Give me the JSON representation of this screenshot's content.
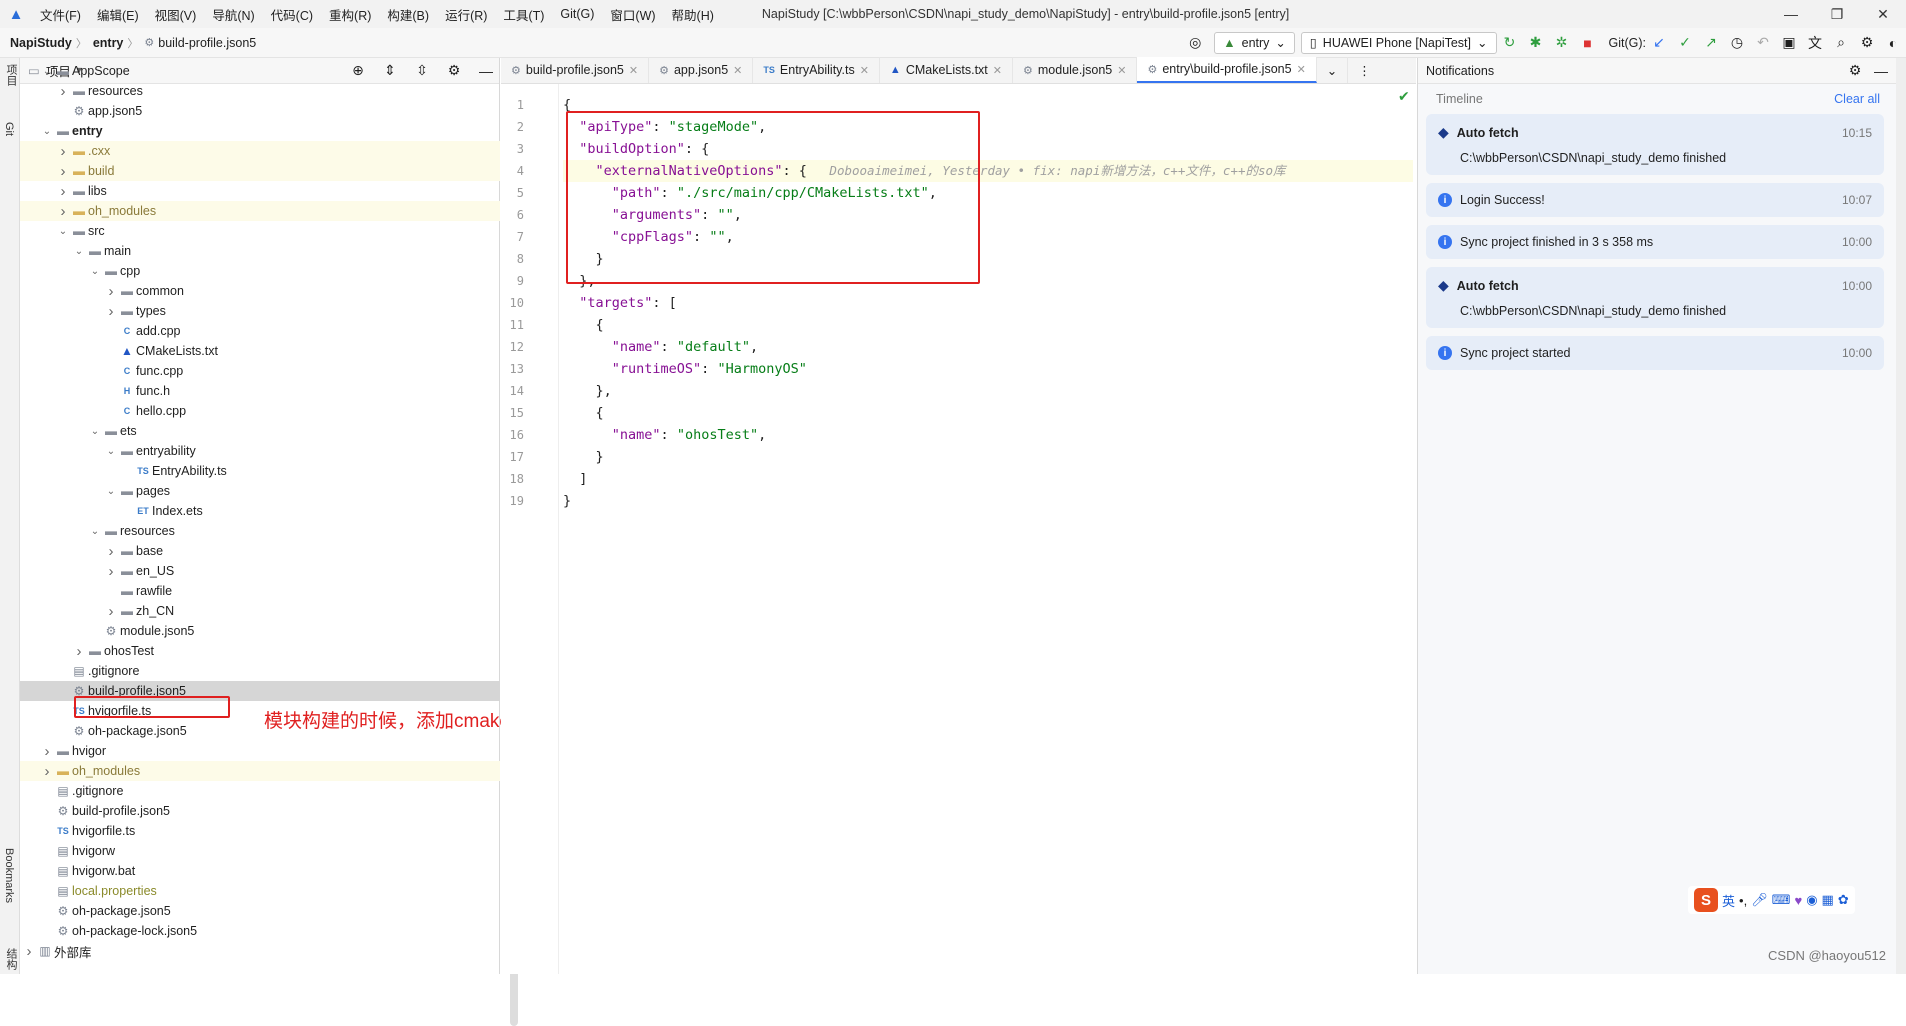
{
  "menubar": {
    "items": [
      "文件(F)",
      "编辑(E)",
      "视图(V)",
      "导航(N)",
      "代码(C)",
      "重构(R)",
      "构建(B)",
      "运行(R)",
      "工具(T)",
      "Git(G)",
      "窗口(W)",
      "帮助(H)"
    ],
    "title": "NapiStudy [C:\\wbbPerson\\CSDN\\napi_study_demo\\NapiStudy] - entry\\build-profile.json5 [entry]"
  },
  "navbar": {
    "breadcrumb": [
      "NapiStudy",
      "entry",
      "build-profile.json5"
    ],
    "module": "entry",
    "device": "HUAWEI Phone [NapiTest]",
    "git_label": "Git(G):"
  },
  "leftstrip": {
    "project": "项目",
    "git": "Git",
    "bookmarks": "Bookmarks",
    "structure": "结构"
  },
  "project": {
    "title": "项目",
    "tree": [
      {
        "label": "AppScope",
        "depth": 0,
        "arrow": "open",
        "icon": "folder"
      },
      {
        "label": "resources",
        "depth": 1,
        "arrow": "closed",
        "icon": "folder"
      },
      {
        "label": "app.json5",
        "depth": 1,
        "arrow": "",
        "icon": "json"
      },
      {
        "label": "entry",
        "depth": 0,
        "arrow": "open",
        "icon": "folder",
        "bold": true
      },
      {
        "label": ".cxx",
        "depth": 1,
        "arrow": "closed",
        "icon": "folder-y",
        "hl": true,
        "dim": true
      },
      {
        "label": "build",
        "depth": 1,
        "arrow": "closed",
        "icon": "folder-y",
        "hl": true,
        "dim": true
      },
      {
        "label": "libs",
        "depth": 1,
        "arrow": "closed",
        "icon": "folder"
      },
      {
        "label": "oh_modules",
        "depth": 1,
        "arrow": "closed",
        "icon": "folder-y",
        "hl": true,
        "dim": true
      },
      {
        "label": "src",
        "depth": 1,
        "arrow": "open",
        "icon": "folder"
      },
      {
        "label": "main",
        "depth": 2,
        "arrow": "open",
        "icon": "folder"
      },
      {
        "label": "cpp",
        "depth": 3,
        "arrow": "open",
        "icon": "folder"
      },
      {
        "label": "common",
        "depth": 4,
        "arrow": "closed",
        "icon": "folder"
      },
      {
        "label": "types",
        "depth": 4,
        "arrow": "closed",
        "icon": "folder"
      },
      {
        "label": "add.cpp",
        "depth": 4,
        "arrow": "",
        "icon": "cpp"
      },
      {
        "label": "CMakeLists.txt",
        "depth": 4,
        "arrow": "",
        "icon": "cmake"
      },
      {
        "label": "func.cpp",
        "depth": 4,
        "arrow": "",
        "icon": "cpp"
      },
      {
        "label": "func.h",
        "depth": 4,
        "arrow": "",
        "icon": "h"
      },
      {
        "label": "hello.cpp",
        "depth": 4,
        "arrow": "",
        "icon": "cpp"
      },
      {
        "label": "ets",
        "depth": 3,
        "arrow": "open",
        "icon": "folder"
      },
      {
        "label": "entryability",
        "depth": 4,
        "arrow": "open",
        "icon": "folder"
      },
      {
        "label": "EntryAbility.ts",
        "depth": 5,
        "arrow": "",
        "icon": "ts"
      },
      {
        "label": "pages",
        "depth": 4,
        "arrow": "open",
        "icon": "folder"
      },
      {
        "label": "Index.ets",
        "depth": 5,
        "arrow": "",
        "icon": "ets"
      },
      {
        "label": "resources",
        "depth": 3,
        "arrow": "open",
        "icon": "folder"
      },
      {
        "label": "base",
        "depth": 4,
        "arrow": "closed",
        "icon": "folder"
      },
      {
        "label": "en_US",
        "depth": 4,
        "arrow": "closed",
        "icon": "folder"
      },
      {
        "label": "rawfile",
        "depth": 4,
        "arrow": "",
        "icon": "folder"
      },
      {
        "label": "zh_CN",
        "depth": 4,
        "arrow": "closed",
        "icon": "folder"
      },
      {
        "label": "module.json5",
        "depth": 3,
        "arrow": "",
        "icon": "json"
      },
      {
        "label": "ohosTest",
        "depth": 2,
        "arrow": "closed",
        "icon": "folder"
      },
      {
        "label": ".gitignore",
        "depth": 1,
        "arrow": "",
        "icon": "file"
      },
      {
        "label": "build-profile.json5",
        "depth": 1,
        "arrow": "",
        "icon": "json",
        "sel": true
      },
      {
        "label": "hvigorfile.ts",
        "depth": 1,
        "arrow": "",
        "icon": "ts"
      },
      {
        "label": "oh-package.json5",
        "depth": 1,
        "arrow": "",
        "icon": "json"
      },
      {
        "label": "hvigor",
        "depth": 0,
        "arrow": "closed",
        "icon": "folder"
      },
      {
        "label": "oh_modules",
        "depth": 0,
        "arrow": "closed",
        "icon": "folder-y",
        "hl": true,
        "dim": true
      },
      {
        "label": ".gitignore",
        "depth": 0,
        "arrow": "",
        "icon": "file"
      },
      {
        "label": "build-profile.json5",
        "depth": 0,
        "arrow": "",
        "icon": "json"
      },
      {
        "label": "hvigorfile.ts",
        "depth": 0,
        "arrow": "",
        "icon": "ts"
      },
      {
        "label": "hvigorw",
        "depth": 0,
        "arrow": "",
        "icon": "file"
      },
      {
        "label": "hvigorw.bat",
        "depth": 0,
        "arrow": "",
        "icon": "file"
      },
      {
        "label": "local.properties",
        "depth": 0,
        "arrow": "",
        "icon": "file",
        "olive": true
      },
      {
        "label": "oh-package.json5",
        "depth": 0,
        "arrow": "",
        "icon": "json"
      },
      {
        "label": "oh-package-lock.json5",
        "depth": 0,
        "arrow": "",
        "icon": "json"
      },
      {
        "label": "外部库",
        "depth": -1,
        "arrow": "closed",
        "icon": "lib"
      }
    ],
    "annotation": "模块构建的时候，添加cmakelist文件"
  },
  "editor": {
    "tabs": [
      {
        "label": "build-profile.json5",
        "icon": "json"
      },
      {
        "label": "app.json5",
        "icon": "json"
      },
      {
        "label": "EntryAbility.ts",
        "icon": "ts"
      },
      {
        "label": "CMakeLists.txt",
        "icon": "cmake"
      },
      {
        "label": "module.json5",
        "icon": "json"
      },
      {
        "label": "entry\\build-profile.json5",
        "icon": "json",
        "active": true
      }
    ],
    "lines": [
      [
        {
          "t": "{",
          "c": "p"
        }
      ],
      [
        {
          "t": "  \"apiType\"",
          "c": "k"
        },
        {
          "t": ": ",
          "c": "p"
        },
        {
          "t": "\"stageMode\"",
          "c": "s"
        },
        {
          "t": ",",
          "c": "p"
        }
      ],
      [
        {
          "t": "  \"buildOption\"",
          "c": "k"
        },
        {
          "t": ": {",
          "c": "p"
        }
      ],
      [
        {
          "t": "    \"externalNativeOptions\"",
          "c": "k"
        },
        {
          "t": ": {",
          "c": "p"
        },
        {
          "t": "   Dobooaimeimei, Yesterday • fix: napi新增方法，c++文件，c++的so库",
          "c": "blame"
        }
      ],
      [
        {
          "t": "      \"path\"",
          "c": "k"
        },
        {
          "t": ": ",
          "c": "p"
        },
        {
          "t": "\"./src/main/cpp/CMakeLists.txt\"",
          "c": "s"
        },
        {
          "t": ",",
          "c": "p"
        }
      ],
      [
        {
          "t": "      \"arguments\"",
          "c": "k"
        },
        {
          "t": ": ",
          "c": "p"
        },
        {
          "t": "\"\"",
          "c": "s"
        },
        {
          "t": ",",
          "c": "p"
        }
      ],
      [
        {
          "t": "      \"cppFlags\"",
          "c": "k"
        },
        {
          "t": ": ",
          "c": "p"
        },
        {
          "t": "\"\"",
          "c": "s"
        },
        {
          "t": ",",
          "c": "p"
        }
      ],
      [
        {
          "t": "    }",
          "c": "p"
        }
      ],
      [
        {
          "t": "  },",
          "c": "p"
        }
      ],
      [
        {
          "t": "  \"targets\"",
          "c": "k"
        },
        {
          "t": ": [",
          "c": "p"
        }
      ],
      [
        {
          "t": "    {",
          "c": "p"
        }
      ],
      [
        {
          "t": "      \"name\"",
          "c": "k"
        },
        {
          "t": ": ",
          "c": "p"
        },
        {
          "t": "\"default\"",
          "c": "s"
        },
        {
          "t": ",",
          "c": "p"
        }
      ],
      [
        {
          "t": "      \"runtimeOS\"",
          "c": "k"
        },
        {
          "t": ": ",
          "c": "p"
        },
        {
          "t": "\"HarmonyOS\"",
          "c": "s"
        }
      ],
      [
        {
          "t": "    },",
          "c": "p"
        }
      ],
      [
        {
          "t": "    {",
          "c": "p"
        }
      ],
      [
        {
          "t": "      \"name\"",
          "c": "k"
        },
        {
          "t": ": ",
          "c": "p"
        },
        {
          "t": "\"ohosTest\"",
          "c": "s"
        },
        {
          "t": ",",
          "c": "p"
        }
      ],
      [
        {
          "t": "    }",
          "c": "p"
        }
      ],
      [
        {
          "t": "  ]",
          "c": "p"
        }
      ],
      [
        {
          "t": "}",
          "c": "p"
        }
      ]
    ],
    "current_line": 4
  },
  "notifications": {
    "title": "Notifications",
    "timeline": "Timeline",
    "clear": "Clear all",
    "items": [
      {
        "type": "git",
        "title": "Auto fetch",
        "time": "10:15",
        "body": "C:\\wbbPerson\\CSDN\\napi_study_demo finished"
      },
      {
        "type": "info",
        "title": "Login Success!",
        "time": "10:07",
        "body": ""
      },
      {
        "type": "info",
        "title": "Sync project finished in 3 s 358 ms",
        "time": "10:00",
        "body": ""
      },
      {
        "type": "git",
        "title": "Auto fetch",
        "time": "10:00",
        "body": "C:\\wbbPerson\\CSDN\\napi_study_demo finished"
      },
      {
        "type": "info",
        "title": "Sync project started",
        "time": "10:00",
        "body": ""
      }
    ]
  },
  "ime": {
    "lang": "英"
  },
  "watermark": "CSDN @haoyou512"
}
